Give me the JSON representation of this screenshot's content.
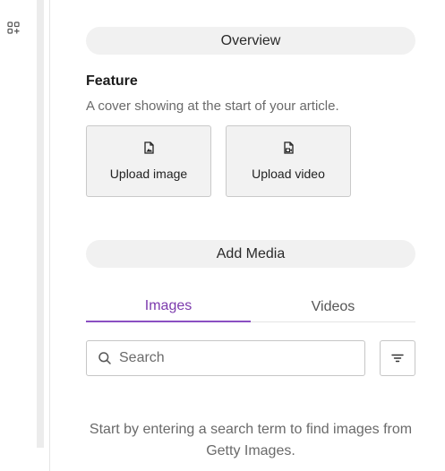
{
  "rail": {
    "icon": "grid-plus-icon"
  },
  "panel": {
    "overview_label": "Overview",
    "feature": {
      "title": "Feature",
      "description": "A cover showing at the start of your article.",
      "upload_image_label": "Upload image",
      "upload_video_label": "Upload video",
      "upload_image_icon": "image-file-icon",
      "upload_video_icon": "video-file-icon"
    },
    "add_media_label": "Add Media",
    "tabs": [
      {
        "label": "Images",
        "active": true
      },
      {
        "label": "Videos",
        "active": false
      }
    ],
    "search": {
      "placeholder": "Search",
      "value": "",
      "icon": "search-icon"
    },
    "filter": {
      "icon": "filter-icon"
    },
    "hint": "Start by entering a search term to find images from Getty Images."
  },
  "colors": {
    "accent": "#8a4fc2",
    "pill_bg": "#f1f1f1",
    "button_bg": "#f2f2f2"
  }
}
